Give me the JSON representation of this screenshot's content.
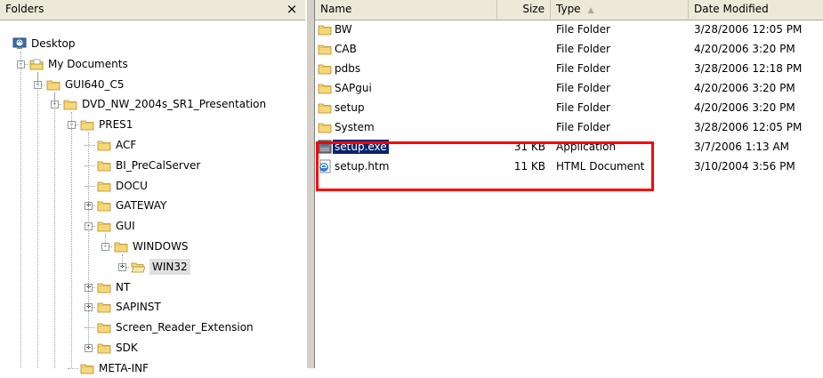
{
  "folders_pane": {
    "title": "Folders",
    "close_glyph": "×",
    "tree": [
      {
        "label": "Desktop",
        "icon": "desktop-icon",
        "expander": ""
      },
      {
        "label": "My Documents",
        "icon": "my-documents-icon",
        "expander": "−"
      },
      {
        "label": "GUI640_C5",
        "icon": "folder-icon",
        "expander": "−"
      },
      {
        "label": "DVD_NW_2004s_SR1_Presentation",
        "icon": "folder-icon",
        "expander": "−"
      },
      {
        "label": "PRES1",
        "icon": "folder-icon",
        "expander": "−"
      },
      {
        "label": "ACF",
        "icon": "folder-icon",
        "expander": ""
      },
      {
        "label": "BI_PreCalServer",
        "icon": "folder-icon",
        "expander": ""
      },
      {
        "label": "DOCU",
        "icon": "folder-icon",
        "expander": ""
      },
      {
        "label": "GATEWAY",
        "icon": "folder-icon",
        "expander": "+"
      },
      {
        "label": "GUI",
        "icon": "folder-icon",
        "expander": "−"
      },
      {
        "label": "WINDOWS",
        "icon": "folder-icon",
        "expander": "−"
      },
      {
        "label": "WIN32",
        "icon": "open-folder-icon",
        "expander": "+"
      },
      {
        "label": "NT",
        "icon": "folder-icon",
        "expander": "+"
      },
      {
        "label": "SAPINST",
        "icon": "folder-icon",
        "expander": "+"
      },
      {
        "label": "Screen_Reader_Extension",
        "icon": "folder-icon",
        "expander": ""
      },
      {
        "label": "SDK",
        "icon": "folder-icon",
        "expander": "+"
      },
      {
        "label": "META-INF",
        "icon": "folder-icon",
        "expander": ""
      }
    ]
  },
  "file_list": {
    "columns": {
      "name": "Name",
      "size": "Size",
      "type": "Type",
      "date": "Date Modified"
    },
    "sort_indicator": "▲",
    "rows": [
      {
        "name": "BW",
        "size": "",
        "type": "File Folder",
        "date": "3/28/2006 12:05 PM",
        "icon": "folder-icon"
      },
      {
        "name": "CAB",
        "size": "",
        "type": "File Folder",
        "date": "4/20/2006 3:20 PM",
        "icon": "folder-icon"
      },
      {
        "name": "pdbs",
        "size": "",
        "type": "File Folder",
        "date": "3/28/2006 12:18 PM",
        "icon": "folder-icon"
      },
      {
        "name": "SAPgui",
        "size": "",
        "type": "File Folder",
        "date": "4/20/2006 3:20 PM",
        "icon": "folder-icon"
      },
      {
        "name": "setup",
        "size": "",
        "type": "File Folder",
        "date": "4/20/2006 3:20 PM",
        "icon": "folder-icon"
      },
      {
        "name": "System",
        "size": "",
        "type": "File Folder",
        "date": "3/28/2006 12:05 PM",
        "icon": "folder-icon"
      },
      {
        "name": "setup.exe",
        "size": "31 KB",
        "type": "Application",
        "date": "3/7/2006 1:13 AM",
        "icon": "application-icon"
      },
      {
        "name": "setup.htm",
        "size": "11 KB",
        "type": "HTML Document",
        "date": "3/10/2004 3:56 PM",
        "icon": "html-document-icon"
      }
    ]
  },
  "colors": {
    "highlight_box": "#ff0000",
    "selection": "#0a246a",
    "header_bg": "#ece9d8"
  }
}
